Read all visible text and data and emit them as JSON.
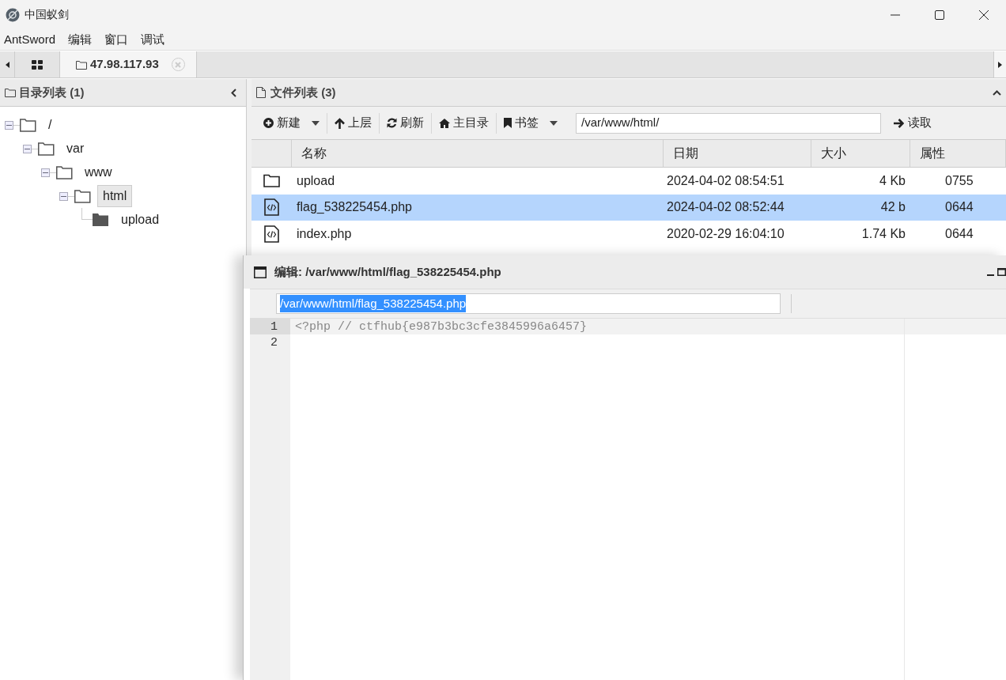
{
  "window": {
    "title": "中国蚁剑"
  },
  "menu": [
    "AntSword",
    "编辑",
    "窗口",
    "调试"
  ],
  "tabs": [
    {
      "kind": "home",
      "selected": false
    },
    {
      "kind": "host",
      "label": "47.98.117.93",
      "selected": true
    }
  ],
  "directory_panel": {
    "title": "目录列表 (1)",
    "tree": [
      {
        "label": "/",
        "expanded": true,
        "selected": false,
        "children": [
          {
            "label": "var",
            "expanded": true,
            "selected": false,
            "children": [
              {
                "label": "www",
                "expanded": true,
                "selected": false,
                "children": [
                  {
                    "label": "html",
                    "expanded": true,
                    "selected": true,
                    "children": [
                      {
                        "label": "upload",
                        "expanded": false,
                        "selected": false
                      }
                    ]
                  }
                ]
              }
            ]
          }
        ]
      }
    ]
  },
  "file_panel": {
    "title": "文件列表 (3)",
    "toolbar": [
      {
        "kind": "new",
        "label": "新建",
        "dropdown": true
      },
      {
        "kind": "up",
        "label": "上层",
        "dropdown": false
      },
      {
        "kind": "refresh",
        "label": "刷新",
        "dropdown": false
      },
      {
        "kind": "home",
        "label": "主目录",
        "dropdown": false
      },
      {
        "kind": "bookmark",
        "label": "书签",
        "dropdown": true
      }
    ],
    "path": "/var/www/html/",
    "read_button": "读取",
    "columns": [
      "名称",
      "日期",
      "大小",
      "属性"
    ],
    "rows": [
      {
        "kind": "folder",
        "name": "upload",
        "date": "2024-04-02 08:54:51",
        "size": "4 Kb",
        "mode": "0755",
        "selected": false
      },
      {
        "kind": "file",
        "name": "flag_538225454.php",
        "date": "2024-04-02 08:52:44",
        "size": "42 b",
        "mode": "0644",
        "selected": true
      },
      {
        "kind": "file",
        "name": "index.php",
        "date": "2020-02-29 16:04:10",
        "size": "1.74 Kb",
        "mode": "0644",
        "selected": false
      }
    ]
  },
  "editor": {
    "title": "编辑: /var/www/html/flag_538225454.php",
    "path": "/var/www/html/flag_538225454.php",
    "path_selected": true,
    "lines": [
      {
        "number": "1",
        "code": "<?php // ctfhub{e987b3bc3cfe3845996a6457}",
        "current": true
      },
      {
        "number": "2",
        "current": false
      }
    ]
  }
}
